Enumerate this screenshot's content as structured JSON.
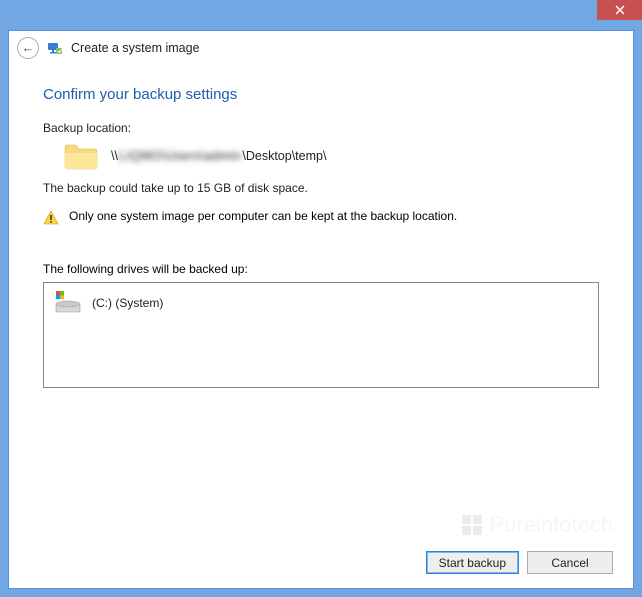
{
  "window": {
    "title": "Create a system image"
  },
  "main": {
    "heading": "Confirm your backup settings",
    "backup_location_label": "Backup location:",
    "backup_path_prefix": "\\\\",
    "backup_path_blurred": "LIQMO\\Users\\admin",
    "backup_path_suffix": "\\Desktop\\temp\\",
    "size_note": "The backup could take up to 15 GB of disk space.",
    "warning": "Only one system image per computer can be kept at the backup location.",
    "drives_label": "The following drives will be backed up:",
    "drives": [
      {
        "label": "(C:) (System)"
      }
    ]
  },
  "buttons": {
    "start": "Start backup",
    "cancel": "Cancel"
  },
  "watermark": "Pureinfotech"
}
